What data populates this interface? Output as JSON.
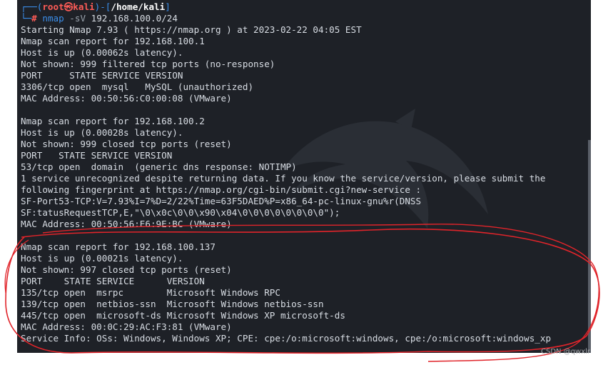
{
  "prompt": {
    "corner_top": "┌──(",
    "user": "root",
    "at_symbol": "㉿",
    "host": "kali",
    "path_open": ")-[",
    "path": "/home/kali",
    "path_close": "]",
    "corner_bottom": "└─",
    "hash": "#",
    "command": "nmap",
    "args": "-sV",
    "target": "192.168.100.0/24"
  },
  "output_lines": [
    "Starting Nmap 7.93 ( https://nmap.org ) at 2023-02-22 04:05 EST",
    "Nmap scan report for 192.168.100.1",
    "Host is up (0.00062s latency).",
    "Not shown: 999 filtered tcp ports (no-response)",
    "PORT     STATE SERVICE VERSION",
    "3306/tcp open  mysql   MySQL (unauthorized)",
    "MAC Address: 00:50:56:C0:00:08 (VMware)",
    "",
    "Nmap scan report for 192.168.100.2",
    "Host is up (0.00028s latency).",
    "Not shown: 999 closed tcp ports (reset)",
    "PORT   STATE SERVICE VERSION",
    "53/tcp open  domain  (generic dns response: NOTIMP)",
    "1 service unrecognized despite returning data. If you know the service/version, please submit the",
    "following fingerprint at https://nmap.org/cgi-bin/submit.cgi?new-service :",
    "SF-Port53-TCP:V=7.93%I=7%D=2/22%Time=63F5DAED%P=x86_64-pc-linux-gnu%r(DNSS",
    "SF:tatusRequestTCP,E,\"\\0\\x0c\\0\\0\\x90\\x04\\0\\0\\0\\0\\0\\0\\0\\0\");",
    "MAC Address: 00:50:56:E6:9E:BC (VMware)",
    "",
    "Nmap scan report for 192.168.100.137",
    "Host is up (0.00021s latency).",
    "Not shown: 997 closed tcp ports (reset)",
    "PORT    STATE SERVICE      VERSION",
    "135/tcp open  msrpc        Microsoft Windows RPC",
    "139/tcp open  netbios-ssn  Microsoft Windows netbios-ssn",
    "445/tcp open  microsoft-ds Microsoft Windows XP microsoft-ds",
    "MAC Address: 00:0C:29:AC:F3:81 (VMware)",
    "Service Info: OSs: Windows, Windows XP; CPE: cpe:/o:microsoft:windows, cpe:/o:microsoft:windows_xp"
  ],
  "watermark": "CSDN @qwxlr",
  "colors": {
    "background": "#1e2127",
    "text": "#d8dde4",
    "prompt_blue": "#3b8eea",
    "prompt_red": "#ff5c57",
    "annotation_red": "#e0242a"
  }
}
